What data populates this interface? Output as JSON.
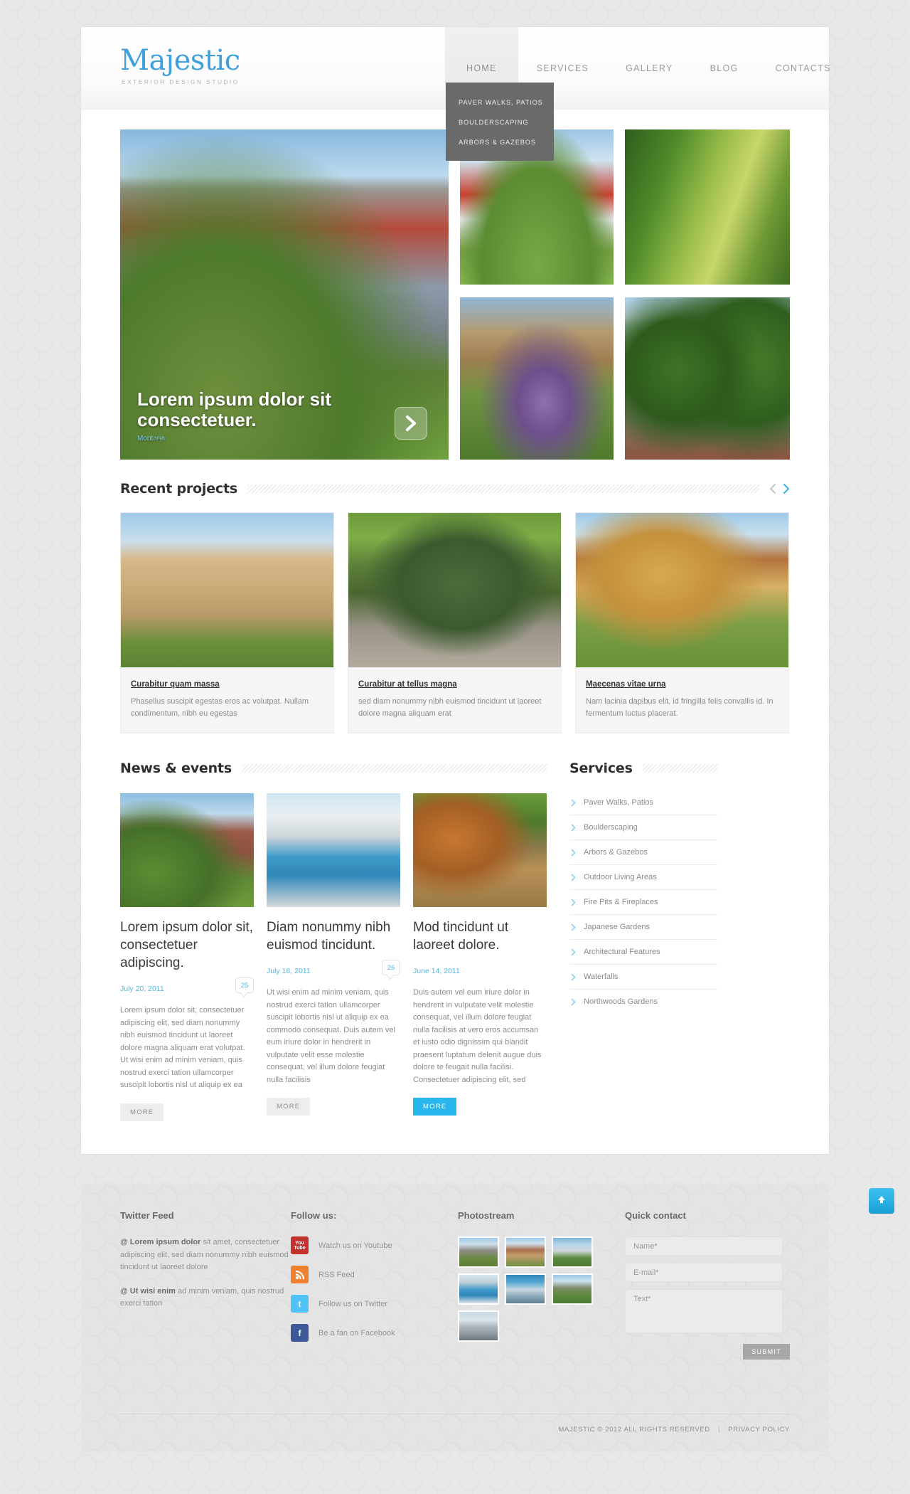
{
  "header": {
    "logo_name": "Majestic",
    "logo_tagline": "EXTERIOR DESIGN STUDIO",
    "nav": [
      {
        "label": "HOME",
        "active": true
      },
      {
        "label": "SERVICES",
        "active": false
      },
      {
        "label": "GALLERY",
        "active": false
      },
      {
        "label": "BLOG",
        "active": false
      },
      {
        "label": "CONTACTS",
        "active": false
      }
    ],
    "dropdown": [
      {
        "label": "PAVER WALKS, PATIOS"
      },
      {
        "label": "BOULDERSCAPING"
      },
      {
        "label": "ARBORS & GAZEBOS"
      }
    ]
  },
  "hero": {
    "slide_title": "Lorem ipsum dolor sit consectetuer.",
    "slide_subtitle": "Montana",
    "next_icon": "chevron-right-icon",
    "tiles": [
      {
        "name": "hero-main-image"
      },
      {
        "name": "hero-tile-house"
      },
      {
        "name": "hero-tile-hedge-maze"
      },
      {
        "name": "hero-tile-flowers"
      },
      {
        "name": "hero-tile-topiary-garden"
      }
    ]
  },
  "projects": {
    "title": "Recent projects",
    "prev_icon": "chevron-left-icon",
    "next_icon": "chevron-right-icon",
    "items": [
      {
        "link": "Curabitur quam massa",
        "desc": "Phasellus suscipit egestas eros ac volutpat. Nullam condimentum, nibh eu egestas"
      },
      {
        "link": "Curabitur at tellus magna",
        "desc": "sed diam nonummy nibh euismod tincidunt ut laoreet dolore magna aliquam erat"
      },
      {
        "link": "Maecenas vitae urna",
        "desc": "Nam lacinia dapibus elit, id fringilla felis convallis id. In fermentum luctus placerat."
      }
    ]
  },
  "news": {
    "title": "News & events",
    "items": [
      {
        "title": "Lorem ipsum dolor sit, consectetuer adipiscing.",
        "date": "July 20, 2011",
        "comments": "25",
        "text": "Lorem ipsum dolor sit, consectetuer adipiscing elit, sed diam nonummy nibh euismod tincidunt ut laoreet dolore magna aliquam erat volutpat. Ut wisi enim ad minim veniam, quis nostrud exerci tation ullamcorper suscipit lobortis nisl ut aliquip ex ea",
        "more_label": "MORE",
        "more_accent": false
      },
      {
        "title": "Diam nonummy nibh euismod tincidunt.",
        "date": "July 18, 2011",
        "comments": "26",
        "text": "Ut wisi enim ad minim veniam, quis nostrud exerci tation ullamcorper suscipit lobortis nisl ut aliquip ex ea commodo consequat. Duis autem vel eum iriure dolor in hendrerit in vulputate velit esse molestie consequat, vel illum dolore feugiat nulla facilisis",
        "more_label": "MORE",
        "more_accent": false
      },
      {
        "title": "Mod tincidunt ut laoreet dolore.",
        "date": "June 14, 2011",
        "comments": "",
        "text": "Duis autem vel eum iriure dolor in hendrerit in vulputate velit molestie consequat, vel illum dolore  feugiat nulla facilisis at vero eros accumsan et iusto odio dignissim qui blandit praesent luptatum delenit augue duis dolore te feugait nulla facilisi. Consectetuer adipiscing elit, sed",
        "more_label": "MORE",
        "more_accent": true
      }
    ]
  },
  "services": {
    "title": "Services",
    "bullet_icon": "chevron-right-icon",
    "items": [
      {
        "label": "Paver Walks, Patios"
      },
      {
        "label": "Boulderscaping"
      },
      {
        "label": "Arbors & Gazebos"
      },
      {
        "label": "Outdoor Living Areas"
      },
      {
        "label": "Fire Pits & Fireplaces"
      },
      {
        "label": "Japanese Gardens"
      },
      {
        "label": "Architectural Features"
      },
      {
        "label": "Waterfalls"
      },
      {
        "label": "Northwoods Gardens"
      }
    ]
  },
  "footer": {
    "twitter": {
      "title": "Twitter Feed",
      "tweets": [
        {
          "handle": "@ Lorem ipsum dolor",
          "text": " sit amet, consectetuer adipiscing elit, sed diam nonummy nibh euismod tincidunt ut laoreet dolore"
        },
        {
          "handle": "@ Ut wisi enim",
          "text": " ad minim veniam, quis nostrud exerci tation"
        }
      ]
    },
    "follow": {
      "title": "Follow us:",
      "items": [
        {
          "icon": "youtube-icon",
          "label": "Watch us on Youtube",
          "glyph_top": "You",
          "glyph_bottom": "Tube"
        },
        {
          "icon": "rss-icon",
          "label": "RSS Feed",
          "glyph": "◔"
        },
        {
          "icon": "twitter-icon",
          "label": "Follow us on Twitter",
          "glyph": "t"
        },
        {
          "icon": "facebook-icon",
          "label": "Be a fan on Facebook",
          "glyph": "f"
        }
      ]
    },
    "photostream": {
      "title": "Photostream",
      "count": 7
    },
    "contact": {
      "title": "Quick contact",
      "name_placeholder": "Name*",
      "email_placeholder": "E-mail*",
      "text_placeholder": "Text*",
      "name_value": "",
      "email_value": "",
      "text_value": "",
      "submit_label": "SUBMIT"
    },
    "copyright": "MAJESTIC © 2012 ALL RIGHTS RESERVED",
    "separator": "|",
    "privacy": "PRIVACY POLICY"
  },
  "scroll_top": {
    "icon": "arrow-up-icon"
  },
  "colors": {
    "accent": "#29b6ec",
    "logo": "#3fa0dc",
    "link": "#52b6e2"
  }
}
